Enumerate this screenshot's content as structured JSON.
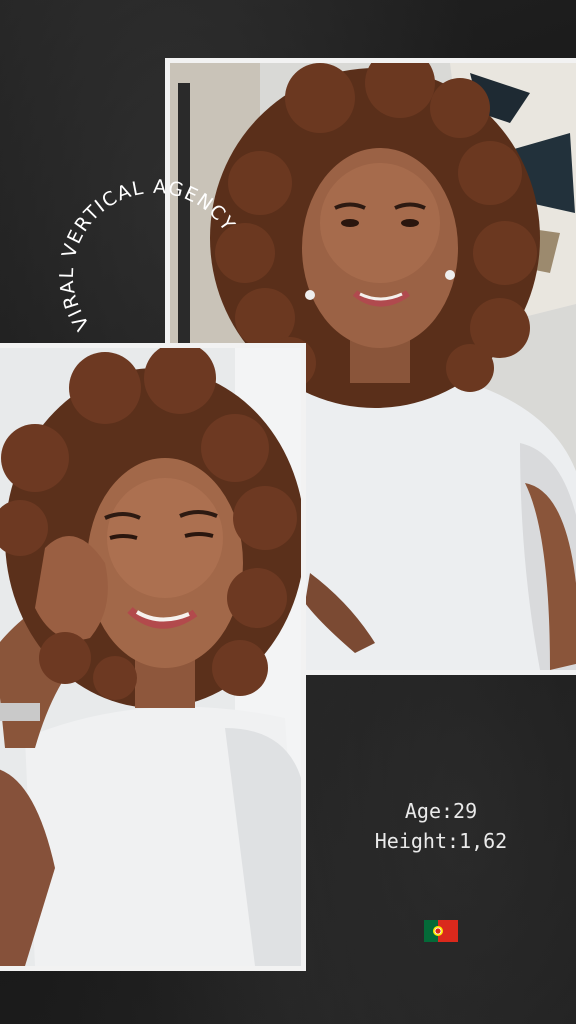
{
  "agency": {
    "name": "VIRAL VERTICAL AGENCY"
  },
  "profile": {
    "age_label": "Age:",
    "age_value": "29",
    "height_label": "Height:",
    "height_value": "1,62",
    "nationality_flag": "portugal-flag-icon"
  },
  "colors": {
    "background": "#1b1b1b",
    "frame": "#f2f2f2",
    "text": "#eaeaea"
  }
}
